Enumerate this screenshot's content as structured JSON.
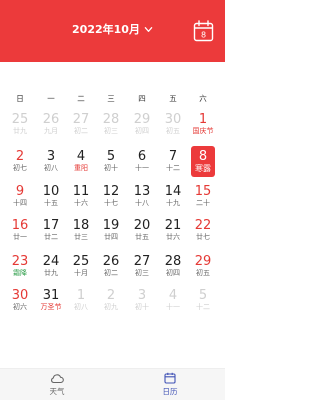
{
  "header": {
    "title": "2022年10月",
    "today_day": "8",
    "accent_color": "#ec3a3b"
  },
  "weekdays": [
    "日",
    "一",
    "二",
    "三",
    "四",
    "五",
    "六"
  ],
  "weeks": [
    [
      {
        "day": "25",
        "sub": "廿九",
        "dim": true
      },
      {
        "day": "26",
        "sub": "九月",
        "dim": true
      },
      {
        "day": "27",
        "sub": "初二",
        "dim": true
      },
      {
        "day": "28",
        "sub": "初三",
        "dim": true
      },
      {
        "day": "29",
        "sub": "初四",
        "dim": true
      },
      {
        "day": "30",
        "sub": "初五",
        "dim": true
      },
      {
        "day": "1",
        "sub": "国庆节",
        "weekend": true,
        "sub_color": "red"
      }
    ],
    [
      {
        "day": "2",
        "sub": "初七",
        "weekend": true
      },
      {
        "day": "3",
        "sub": "初八"
      },
      {
        "day": "4",
        "sub": "重阳",
        "sub_color": "red"
      },
      {
        "day": "5",
        "sub": "初十"
      },
      {
        "day": "6",
        "sub": "十一"
      },
      {
        "day": "7",
        "sub": "十二"
      },
      {
        "day": "8",
        "sub": "寒露",
        "weekend": true,
        "selected": true
      }
    ],
    [
      {
        "day": "9",
        "sub": "十四",
        "weekend": true
      },
      {
        "day": "10",
        "sub": "十五"
      },
      {
        "day": "11",
        "sub": "十六"
      },
      {
        "day": "12",
        "sub": "十七"
      },
      {
        "day": "13",
        "sub": "十八"
      },
      {
        "day": "14",
        "sub": "十九"
      },
      {
        "day": "15",
        "sub": "二十",
        "weekend": true
      }
    ],
    [
      {
        "day": "16",
        "sub": "廿一",
        "weekend": true
      },
      {
        "day": "17",
        "sub": "廿二"
      },
      {
        "day": "18",
        "sub": "廿三"
      },
      {
        "day": "19",
        "sub": "廿四"
      },
      {
        "day": "20",
        "sub": "廿五"
      },
      {
        "day": "21",
        "sub": "廿六"
      },
      {
        "day": "22",
        "sub": "廿七",
        "weekend": true
      }
    ],
    [
      {
        "day": "23",
        "sub": "霜降",
        "weekend": true,
        "sub_color": "green"
      },
      {
        "day": "24",
        "sub": "廿九"
      },
      {
        "day": "25",
        "sub": "十月"
      },
      {
        "day": "26",
        "sub": "初二"
      },
      {
        "day": "27",
        "sub": "初三"
      },
      {
        "day": "28",
        "sub": "初四"
      },
      {
        "day": "29",
        "sub": "初五",
        "weekend": true
      }
    ],
    [
      {
        "day": "30",
        "sub": "初六",
        "weekend": true
      },
      {
        "day": "31",
        "sub": "万圣节",
        "sub_color": "red"
      },
      {
        "day": "1",
        "sub": "初八",
        "dim": true
      },
      {
        "day": "2",
        "sub": "初九",
        "dim": true
      },
      {
        "day": "3",
        "sub": "初十",
        "dim": true
      },
      {
        "day": "4",
        "sub": "十一",
        "dim": true
      },
      {
        "day": "5",
        "sub": "十二",
        "dim": true
      }
    ]
  ],
  "tabs": [
    {
      "label": "天气",
      "icon": "cloud-icon",
      "active": false
    },
    {
      "label": "日历",
      "icon": "calendar-icon",
      "active": true
    }
  ],
  "colors": {
    "active_tab": "#3f51b5",
    "inactive_tab": "#666666",
    "holiday_red": "#e53935",
    "solar_term_green": "#2e9d4a"
  }
}
